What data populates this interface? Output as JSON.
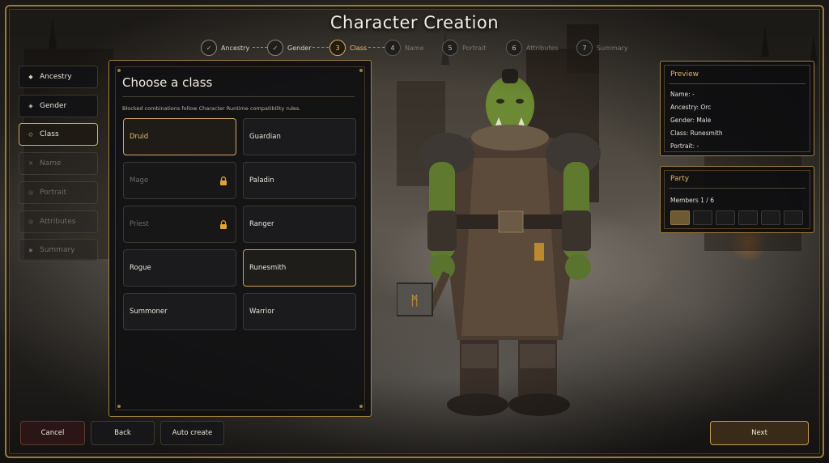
{
  "title": "Character Creation",
  "stepper": [
    {
      "num": "✓",
      "label": "Ancestry",
      "state": "done"
    },
    {
      "num": "✓",
      "label": "Gender",
      "state": "done"
    },
    {
      "num": "3",
      "label": "Class",
      "state": "active"
    },
    {
      "num": "4",
      "label": "Name",
      "state": "pending"
    },
    {
      "num": "5",
      "label": "Portrait",
      "state": "pending"
    },
    {
      "num": "6",
      "label": "Attributes",
      "state": "pending"
    },
    {
      "num": "7",
      "label": "Summary",
      "state": "pending"
    }
  ],
  "nav": [
    {
      "icon": "◆",
      "label": "Ancestry",
      "state": "enabled"
    },
    {
      "icon": "◈",
      "label": "Gender",
      "state": "enabled"
    },
    {
      "icon": "◇",
      "label": "Class",
      "state": "active"
    },
    {
      "icon": "✕",
      "label": "Name",
      "state": "disabled"
    },
    {
      "icon": "◎",
      "label": "Portrait",
      "state": "disabled"
    },
    {
      "icon": "◎",
      "label": "Attributes",
      "state": "disabled"
    },
    {
      "icon": "▪",
      "label": "Summary",
      "state": "disabled"
    }
  ],
  "class_panel": {
    "title": "Choose a class",
    "subtitle": "Blocked combinations follow Character Runtime compatibility rules.",
    "classes": [
      {
        "label": "Druid",
        "state": "highlighted"
      },
      {
        "label": "Guardian",
        "state": "normal"
      },
      {
        "label": "Mage",
        "state": "locked"
      },
      {
        "label": "Paladin",
        "state": "normal"
      },
      {
        "label": "Priest",
        "state": "locked"
      },
      {
        "label": "Ranger",
        "state": "normal"
      },
      {
        "label": "Rogue",
        "state": "normal"
      },
      {
        "label": "Runesmith",
        "state": "selected"
      },
      {
        "label": "Summoner",
        "state": "normal"
      },
      {
        "label": "Warrior",
        "state": "normal"
      }
    ]
  },
  "preview": {
    "title": "Preview",
    "lines": [
      "Name: -",
      "Ancestry: Orc",
      "Gender: Male",
      "Class: Runesmith",
      "Portrait: -"
    ]
  },
  "party": {
    "title": "Party",
    "members": "Members 1 / 6",
    "filled": 1,
    "slots": 6
  },
  "buttons": {
    "cancel": "Cancel",
    "back": "Back",
    "auto_create": "Auto create",
    "next": "Next"
  },
  "colors": {
    "accent_gold": "#d1ad62",
    "preview_title": "#e2b35e",
    "cancel_bg": "#2a1616",
    "next_bg": "#3a2a18"
  }
}
